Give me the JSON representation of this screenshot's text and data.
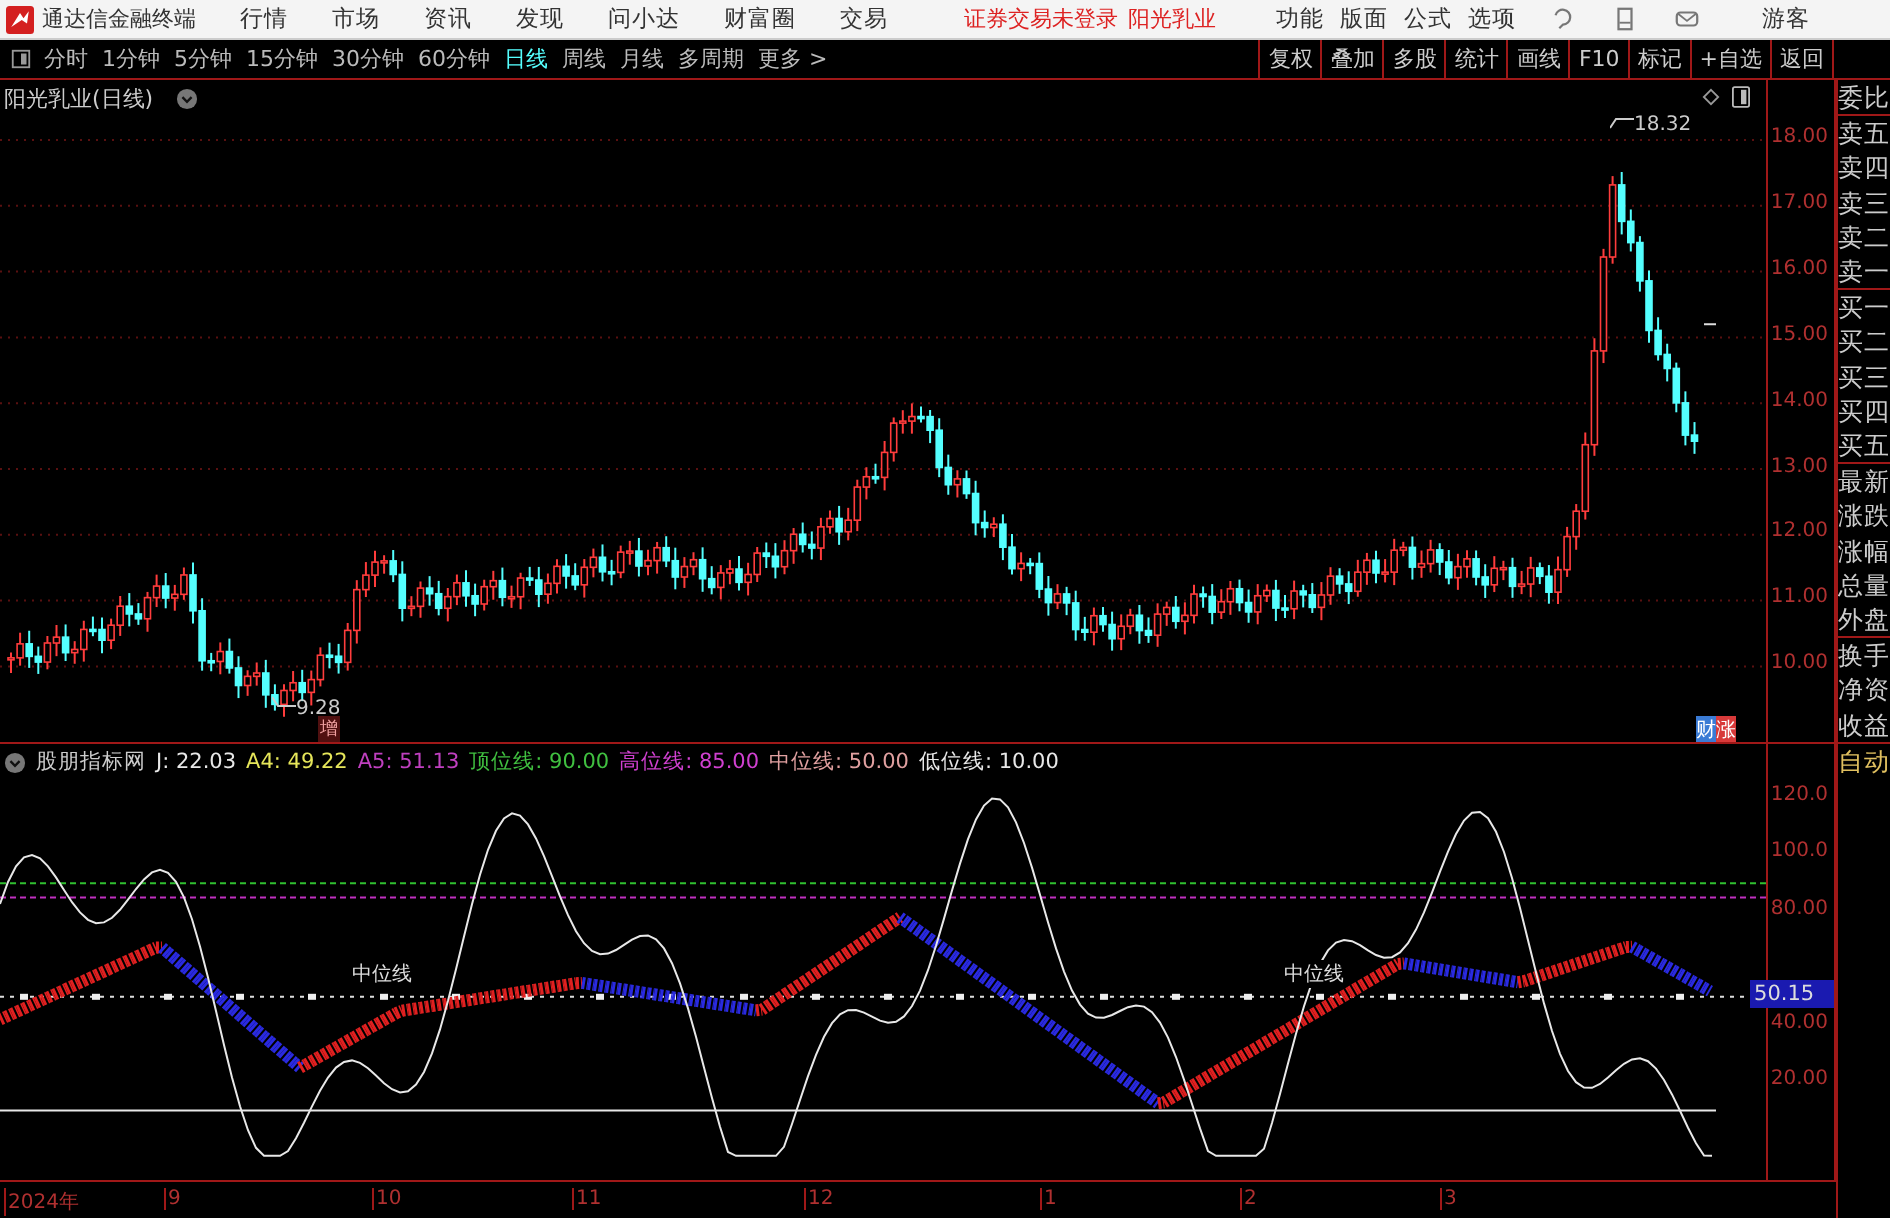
{
  "menu_bar": {
    "app_title": "通达信金融终端",
    "menus": [
      "行情",
      "市场",
      "资讯",
      "发现",
      "问小达",
      "财富圈",
      "交易"
    ],
    "login_status": "证券交易未登录",
    "stock_name": "阳光乳业",
    "functions": [
      "功能",
      "版面",
      "公式",
      "选项"
    ],
    "user": "游客"
  },
  "period_bar": {
    "periods": [
      {
        "label": "分时",
        "selected": false
      },
      {
        "label": "1分钟",
        "selected": false
      },
      {
        "label": "5分钟",
        "selected": false
      },
      {
        "label": "15分钟",
        "selected": false
      },
      {
        "label": "30分钟",
        "selected": false
      },
      {
        "label": "60分钟",
        "selected": false
      },
      {
        "label": "日线",
        "selected": true
      },
      {
        "label": "周线",
        "selected": false
      },
      {
        "label": "月线",
        "selected": false
      },
      {
        "label": "多周期",
        "selected": false
      },
      {
        "label": "更多 >",
        "selected": false
      }
    ],
    "tools": [
      "复权",
      "叠加",
      "多股",
      "统计",
      "画线",
      "F10",
      "标记",
      "+自选",
      "返回"
    ]
  },
  "price_chart": {
    "title": "阳光乳业(日线)",
    "axis_labels": [
      "18.00",
      "17.00",
      "16.00",
      "15.00",
      "14.00",
      "13.00",
      "12.00",
      "11.00",
      "10.00"
    ],
    "high_label": "18.32",
    "low_label": "9.28",
    "event_marker": "增",
    "badges": [
      {
        "label": "财",
        "color": "#3a7bd5"
      },
      {
        "label": "涨",
        "color": "#d83a3a"
      }
    ]
  },
  "indicator": {
    "name": "股朋指标网",
    "readings": [
      {
        "label": "J: 22.03",
        "color": "#e8e8e8"
      },
      {
        "label": "A4: 49.22",
        "color": "#e6e65a"
      },
      {
        "label": "A5: 51.13",
        "color": "#c040c0"
      },
      {
        "label": "顶位线: 90.00",
        "color": "#40c040"
      },
      {
        "label": "高位线: 85.00",
        "color": "#d040d0"
      },
      {
        "label": "中位线: 50.00",
        "color": "#e0a0a0"
      },
      {
        "label": "低位线: 10.00",
        "color": "#e8e8e8"
      }
    ],
    "line_labels": [
      "中位线",
      "中位线"
    ],
    "axis_labels": [
      "120.0",
      "100.0",
      "80.00",
      "40.00",
      "20.00"
    ],
    "current_value": "50.15"
  },
  "time_axis": {
    "labels": [
      "2024年",
      "9",
      "10",
      "11",
      "12",
      "1",
      "2",
      "3"
    ]
  },
  "side_panel": {
    "items": [
      "委比",
      "卖五",
      "卖四",
      "卖三",
      "卖二",
      "卖一",
      "买一",
      "买二",
      "买三",
      "买四",
      "买五",
      "最新",
      "涨跌",
      "涨幅",
      "总量",
      "外盘",
      "换手",
      "净资",
      "收益"
    ],
    "auto_button": "自动"
  }
}
